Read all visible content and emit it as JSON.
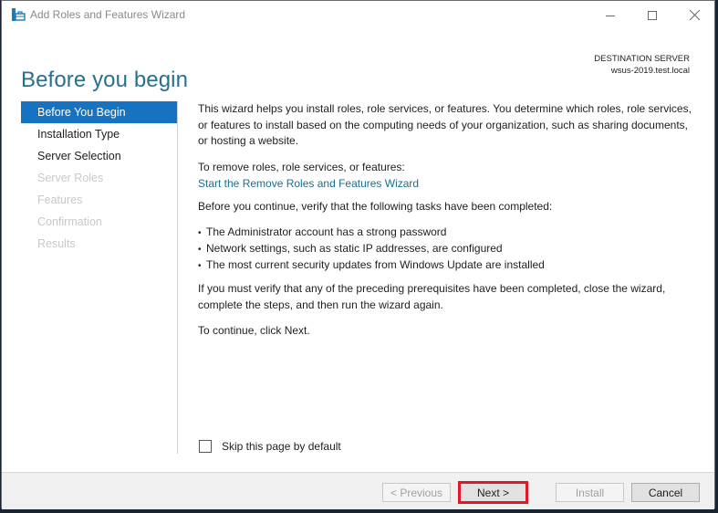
{
  "window": {
    "title": "Add Roles and Features Wizard",
    "icon": "server-manager-icon",
    "controls": [
      "minimize-icon",
      "maximize-icon",
      "close-icon"
    ]
  },
  "header": {
    "page_title": "Before you begin",
    "destination_label": "DESTINATION SERVER",
    "destination_server": "wsus-2019.test.local"
  },
  "nav": {
    "items": [
      {
        "label": "Before You Begin",
        "state": "active"
      },
      {
        "label": "Installation Type",
        "state": "enabled"
      },
      {
        "label": "Server Selection",
        "state": "enabled"
      },
      {
        "label": "Server Roles",
        "state": "disabled"
      },
      {
        "label": "Features",
        "state": "disabled"
      },
      {
        "label": "Confirmation",
        "state": "disabled"
      },
      {
        "label": "Results",
        "state": "disabled"
      }
    ]
  },
  "content": {
    "intro": "This wizard helps you install roles, role services, or features. You determine which roles, role services, or features to install based on the computing needs of your organization, such as sharing documents, or hosting a website.",
    "remove_label": "To remove roles, role services, or features:",
    "remove_link": "Start the Remove Roles and Features Wizard",
    "verify_label": "Before you continue, verify that the following tasks have been completed:",
    "bullets": [
      "The Administrator account has a strong password",
      "Network settings, such as static IP addresses, are configured",
      "The most current security updates from Windows Update are installed"
    ],
    "verify_note": "If you must verify that any of the preceding prerequisites have been completed, close the wizard, complete the steps, and then run the wizard again.",
    "continue_note": "To continue, click Next."
  },
  "skip_checkbox": {
    "label": "Skip this page by default",
    "checked": false
  },
  "footer": {
    "previous_label": "< Previous",
    "next_label": "Next >",
    "install_label": "Install",
    "cancel_label": "Cancel",
    "highlight_color": "#e0182a"
  },
  "colors": {
    "accent": "#1773c2",
    "title": "#2a6f8c",
    "link": "#1a6e8e"
  }
}
